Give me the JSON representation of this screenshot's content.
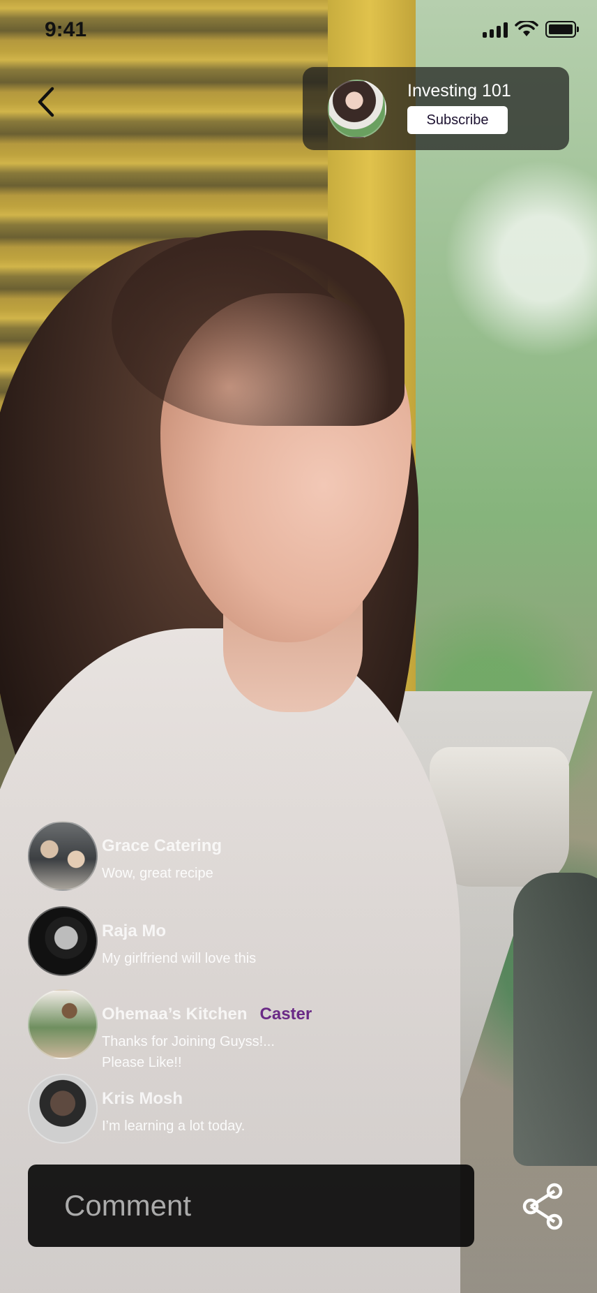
{
  "status_bar": {
    "time": "9:41"
  },
  "channel": {
    "title": "Investing 101",
    "subscribe_label": "Subscribe"
  },
  "comments": [
    {
      "name": "Grace Catering",
      "text": "Wow, great recipe",
      "tag": ""
    },
    {
      "name": "Raja Mo",
      "text": "My girlfriend will love this",
      "tag": ""
    },
    {
      "name": "Ohemaa’s Kitchen",
      "text": "Thanks for Joining Guyss!... Please Like!!",
      "tag": "Caster"
    },
    {
      "name": "Kris Mosh",
      "text": "I’m learning a lot today.",
      "tag": ""
    }
  ],
  "comment_input": {
    "placeholder": "Comment"
  },
  "icons": {
    "back": "chevron-left-icon",
    "share": "share-icon",
    "signal": "cellular-signal-icon",
    "wifi": "wifi-icon",
    "battery": "battery-icon"
  },
  "colors": {
    "caster_tag": "#6a2a86",
    "subscribe_text": "#1c1130"
  }
}
